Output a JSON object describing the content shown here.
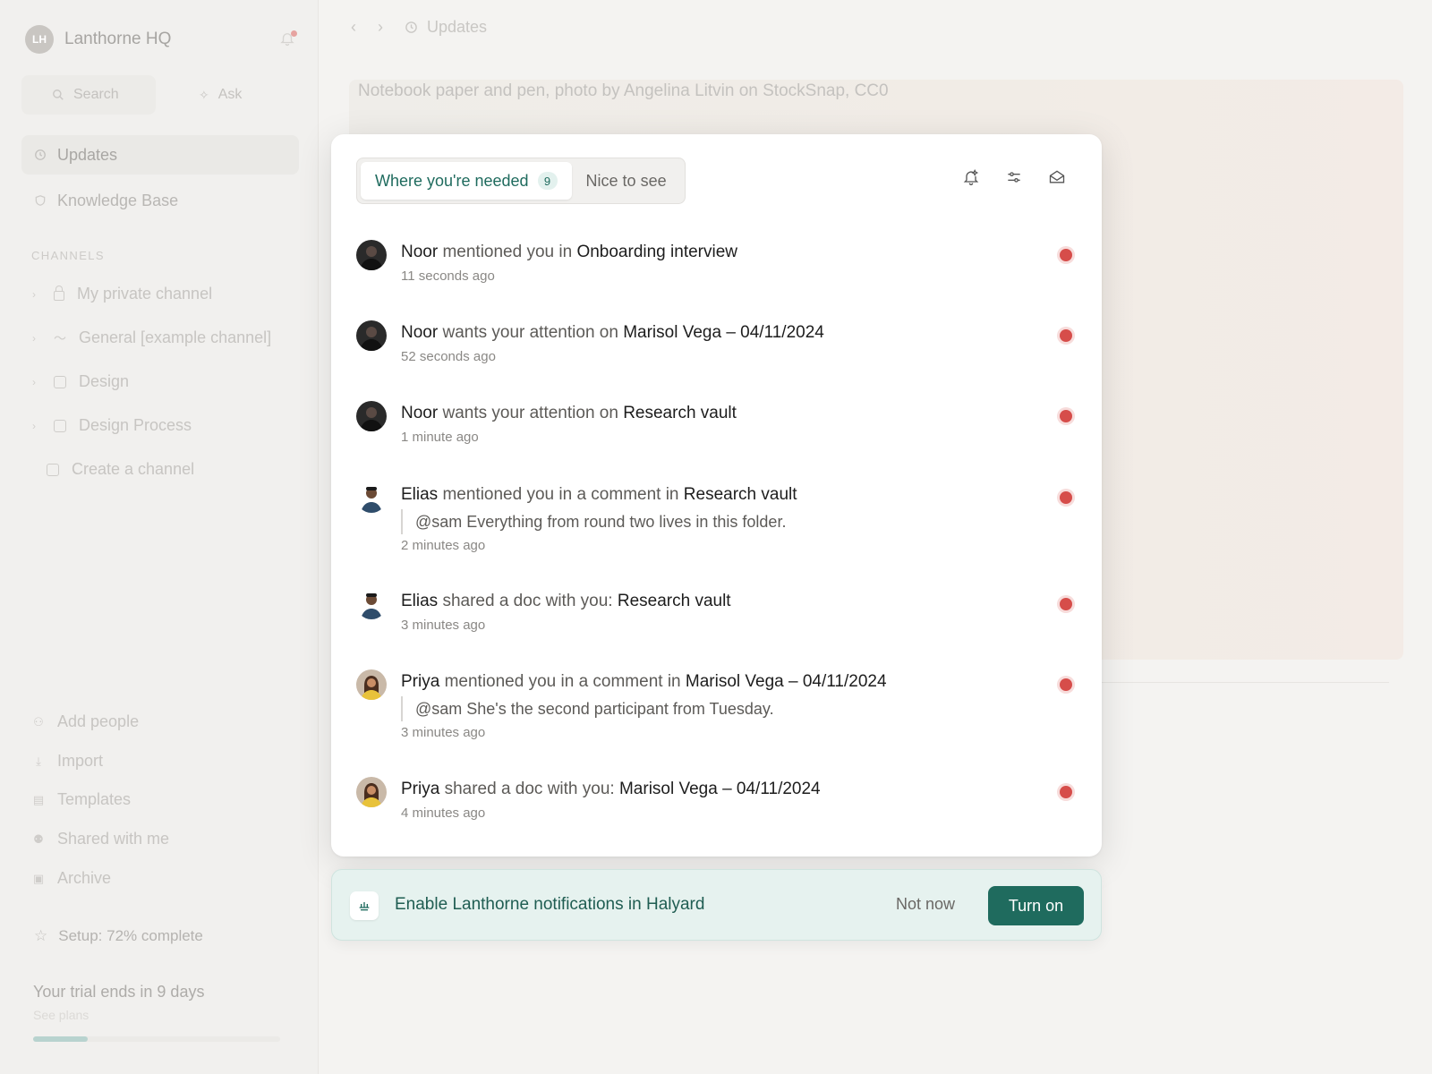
{
  "workspace": {
    "initials": "LH",
    "name": "Lanthorne HQ"
  },
  "sidebar": {
    "search_label": "Search",
    "ask_label": "Ask",
    "nav": [
      {
        "label": "Updates"
      },
      {
        "label": "Knowledge Base"
      }
    ],
    "channels_heading": "CHANNELS",
    "channels": [
      {
        "label": "My private channel",
        "icon": "lock-icon"
      },
      {
        "label": "General [example channel]",
        "icon": "wave-icon"
      },
      {
        "label": "Design",
        "icon": "book-icon"
      },
      {
        "label": "Design Process",
        "icon": "book-icon"
      }
    ],
    "create_channel": "Create a channel",
    "bottom": [
      {
        "label": "Add people",
        "icon": "add-person-icon"
      },
      {
        "label": "Import",
        "icon": "download-icon"
      },
      {
        "label": "Templates",
        "icon": "template-icon"
      },
      {
        "label": "Shared with me",
        "icon": "people-icon"
      },
      {
        "label": "Archive",
        "icon": "archive-icon"
      }
    ],
    "setup": "Setup: 72% complete",
    "trial_title": "Your trial ends in 9 days",
    "trial_sub": "See plans",
    "trial_progress": 0.22
  },
  "topbar": {
    "breadcrumb": "Updates"
  },
  "cover": {
    "alt_text": "Notebook paper and pen, photo by Angelina Litvin on StockSnap, CC0"
  },
  "popover": {
    "tabs": [
      {
        "label": "Where you're needed",
        "count": "9"
      },
      {
        "label": "Nice to see"
      }
    ],
    "notifications": [
      {
        "who": "Noor",
        "action": " mentioned you in ",
        "target": "Onboarding interview",
        "quote": "",
        "time": "11 seconds ago"
      },
      {
        "who": "Noor",
        "action": " wants your attention on ",
        "target": "Marisol Vega – 04/11/2024",
        "quote": "",
        "time": "52 seconds ago"
      },
      {
        "who": "Noor",
        "action": " wants your attention on ",
        "target": "Research vault",
        "quote": "",
        "time": "1 minute ago"
      },
      {
        "who": "Elias",
        "action": " mentioned you in a comment in ",
        "target": "Research vault",
        "quote": "@sam Everything from round two lives in this folder.",
        "time": "2 minutes ago"
      },
      {
        "who": "Elias",
        "action": " shared a doc with you: ",
        "target": "Research vault",
        "quote": "",
        "time": "3 minutes ago"
      },
      {
        "who": "Priya",
        "action": " mentioned you in a comment in ",
        "target": "Marisol Vega – 04/11/2024",
        "quote": "@sam She's the second participant from Tuesday.",
        "time": "3 minutes ago"
      },
      {
        "who": "Priya",
        "action": " shared a doc with you: ",
        "target": "Marisol Vega – 04/11/2024",
        "quote": "",
        "time": "4 minutes ago"
      }
    ]
  },
  "banner": {
    "text": "Enable Lanthorne notifications in Halyard",
    "not_now": "Not now",
    "turn_on": "Turn on"
  },
  "colors": {
    "accent": "#1f6b5e",
    "unread": "#d64d4a",
    "banner_bg": "#e6f2ef"
  }
}
